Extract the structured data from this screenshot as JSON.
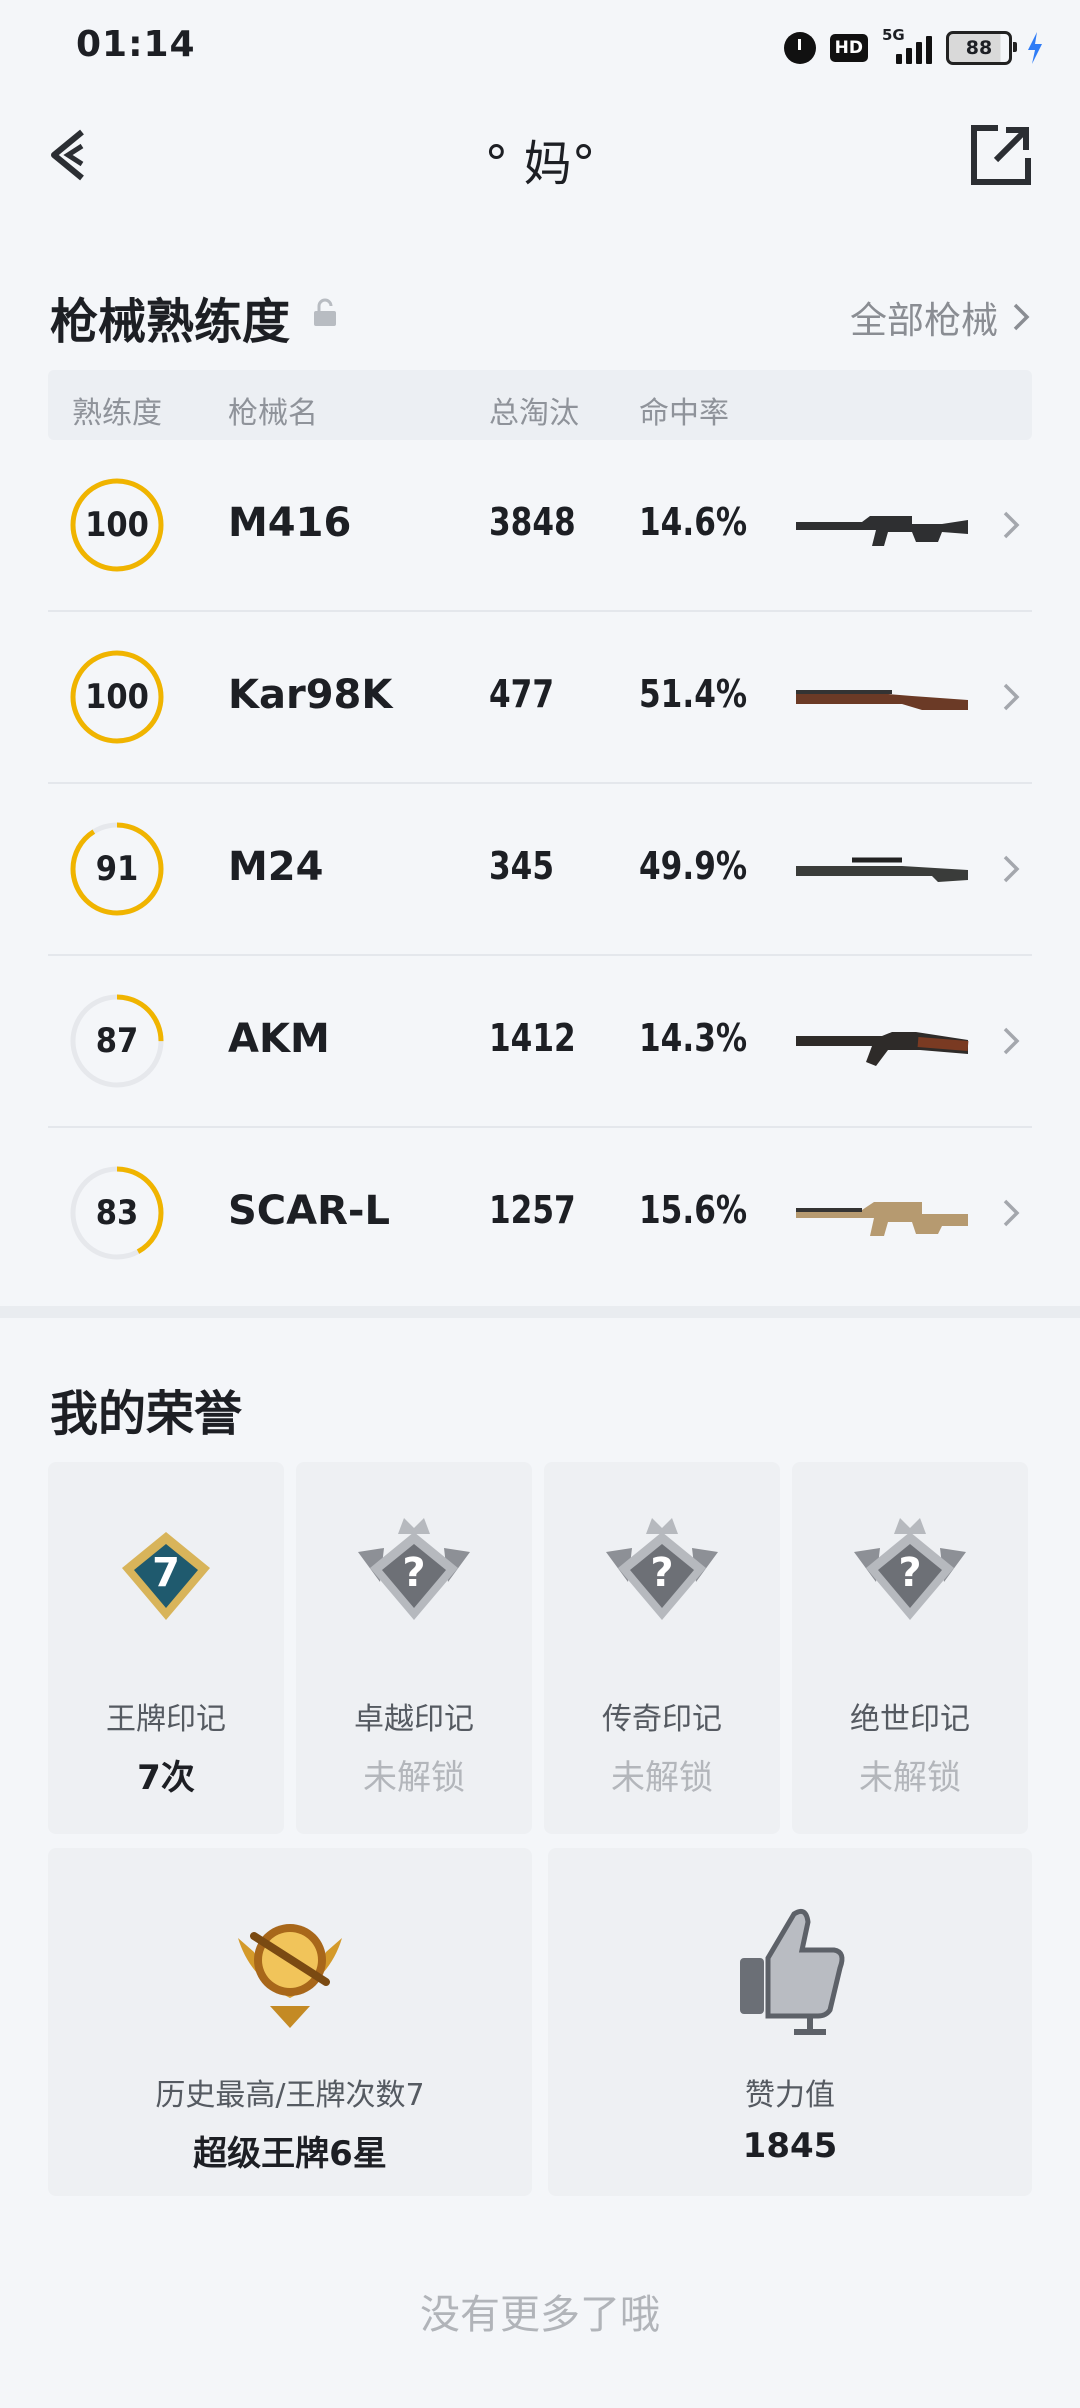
{
  "status_bar": {
    "time": "01:14",
    "hd": "HD",
    "network": "5G",
    "battery": "88"
  },
  "header": {
    "title": "° 妈°"
  },
  "weapons": {
    "section_title": "枪械熟练度",
    "all_link": "全部枪械",
    "columns": [
      "熟练度",
      "枪械名",
      "总淘汰",
      "命中率"
    ],
    "rows": [
      {
        "mastery": "100",
        "mastery_fraction": 1.0,
        "name": "M416",
        "kills": "3848",
        "accuracy": "14.6%",
        "gun_icon": "m416-rifle-icon"
      },
      {
        "mastery": "100",
        "mastery_fraction": 1.0,
        "name": "Kar98K",
        "kills": "477",
        "accuracy": "51.4%",
        "gun_icon": "kar98k-rifle-icon"
      },
      {
        "mastery": "91",
        "mastery_fraction": 0.91,
        "name": "M24",
        "kills": "345",
        "accuracy": "49.9%",
        "gun_icon": "m24-rifle-icon"
      },
      {
        "mastery": "87",
        "mastery_fraction": 0.25,
        "name": "AKM",
        "kills": "1412",
        "accuracy": "14.3%",
        "gun_icon": "akm-rifle-icon"
      },
      {
        "mastery": "83",
        "mastery_fraction": 0.42,
        "name": "SCAR-L",
        "kills": "1257",
        "accuracy": "15.6%",
        "gun_icon": "scarl-rifle-icon"
      }
    ],
    "ring_color": "#f0b400",
    "ring_track_color": "#e6e8ec"
  },
  "honors": {
    "section_title": "我的荣誉",
    "cards": [
      {
        "name": "王牌印记",
        "value": "7次",
        "badge_text": "7",
        "locked": false
      },
      {
        "name": "卓越印记",
        "value": "未解锁",
        "badge_text": "?",
        "locked": true
      },
      {
        "name": "传奇印记",
        "value": "未解锁",
        "badge_text": "?",
        "locked": true
      },
      {
        "name": "绝世印记",
        "value": "未解锁",
        "badge_text": "?",
        "locked": true
      }
    ],
    "highest": {
      "name": "历史最高/王牌次数7",
      "value": "超级王牌6星"
    },
    "likes": {
      "name": "赞力值",
      "value": "1845"
    }
  },
  "footer": {
    "text": "没有更多了哦"
  }
}
